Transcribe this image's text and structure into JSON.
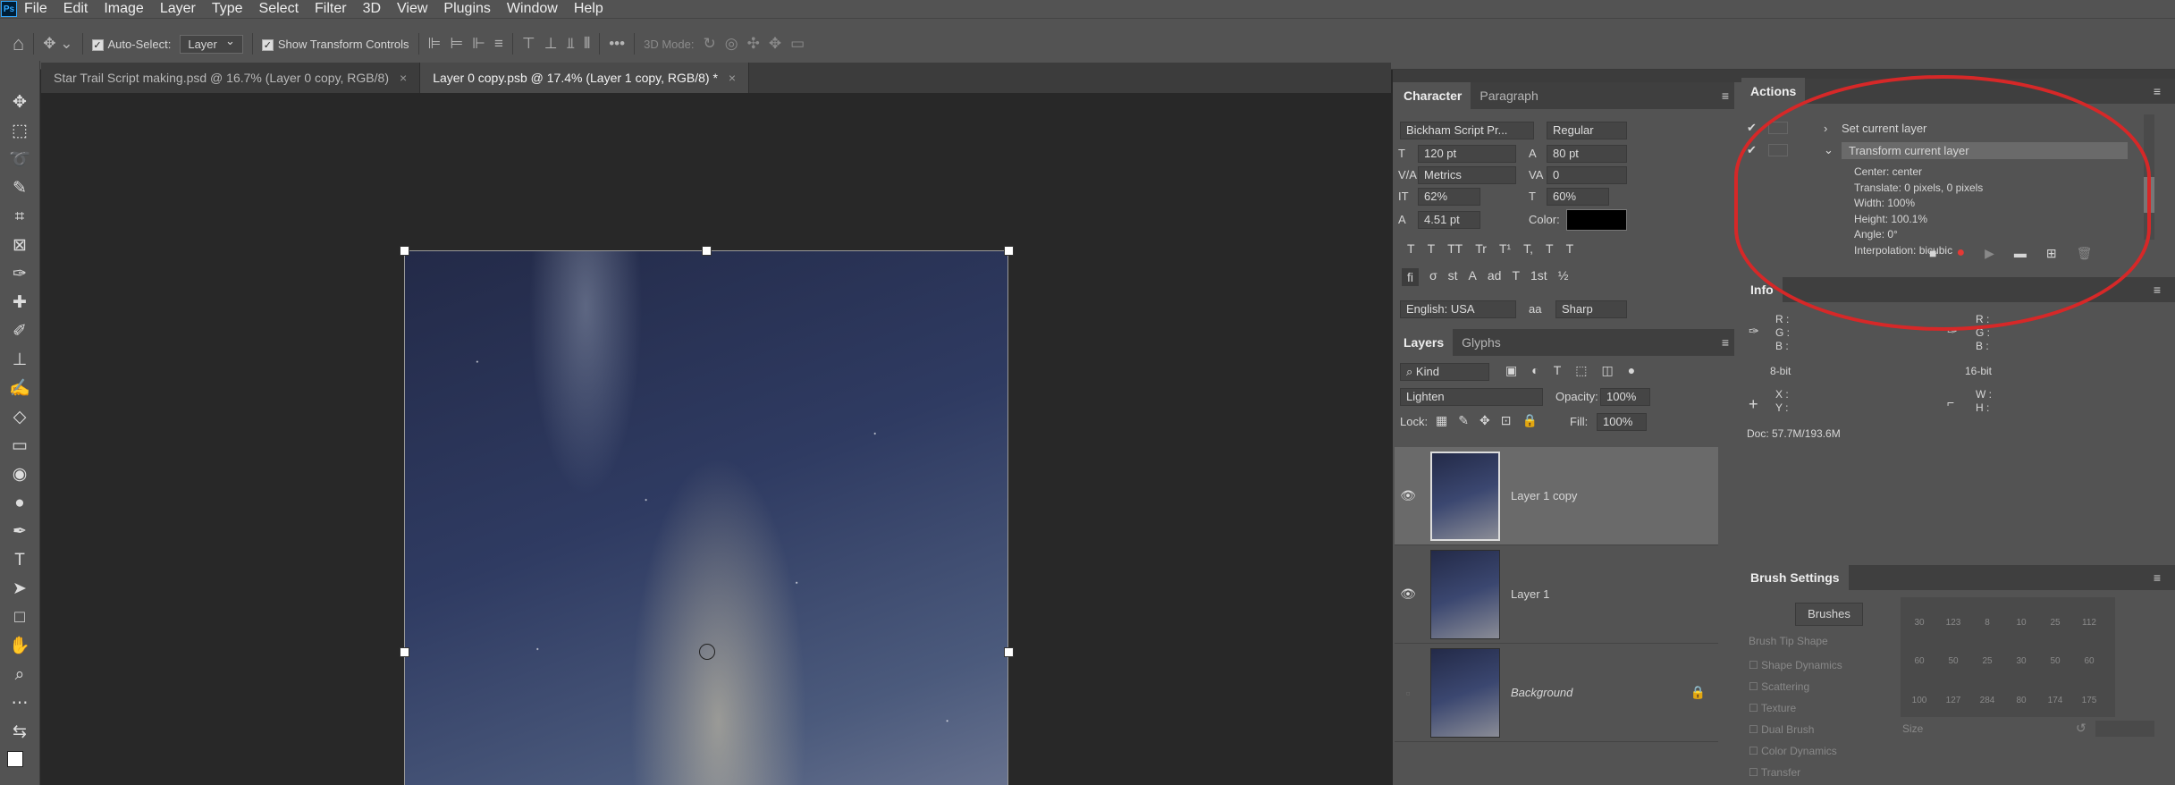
{
  "menu": [
    "File",
    "Edit",
    "Image",
    "Layer",
    "Type",
    "Select",
    "Filter",
    "3D",
    "View",
    "Plugins",
    "Window",
    "Help"
  ],
  "options": {
    "autoselect_label": "Auto-Select:",
    "autoselect_value": "Layer",
    "transform_label": "Show Transform Controls",
    "mode_label": "3D Mode:",
    "more": "•••"
  },
  "tabs": [
    {
      "label": "Star Trail Script making.psd @ 16.7% (Layer 0 copy, RGB/8)"
    },
    {
      "label": "Layer 0 copy.psb @ 17.4% (Layer 1 copy, RGB/8) *"
    }
  ],
  "character": {
    "tab1": "Character",
    "tab2": "Paragraph",
    "font": "Bickham Script Pr...",
    "style": "Regular",
    "size": "120 pt",
    "leading": "80 pt",
    "kerning": "Metrics",
    "tracking": "0",
    "vscale": "62%",
    "hscale": "60%",
    "baseline": "4.51 pt",
    "color_label": "Color:",
    "language": "English: USA",
    "aa_label": "aa",
    "antialias": "Sharp",
    "style_buttons": [
      "T",
      "T",
      "TT",
      "Tr",
      "T¹",
      "T,",
      "T",
      "T"
    ],
    "ot_buttons": [
      "fi",
      "σ",
      "st",
      "A",
      "ad",
      "T",
      "1st",
      "½"
    ]
  },
  "layers": {
    "tab1": "Layers",
    "tab2": "Glyphs",
    "kind": "Kind",
    "blend": "Lighten",
    "opacity_label": "Opacity:",
    "opacity": "100%",
    "lock_label": "Lock:",
    "fill_label": "Fill:",
    "fill": "100%",
    "items": [
      {
        "name": "Layer 1 copy",
        "visible": "true"
      },
      {
        "name": "Layer 1",
        "visible": "true"
      },
      {
        "name": "Background",
        "visible": "false"
      }
    ]
  },
  "actions": {
    "title": "Actions",
    "set_layer": "Set current layer",
    "transform_layer": "Transform current layer",
    "details": [
      "Center: center",
      "Translate: 0 pixels, 0 pixels",
      "Width: 100%",
      "Height: 100.1%",
      "Angle: 0°",
      "Interpolation: bicubic"
    ]
  },
  "info": {
    "title": "Info",
    "rgb": "R :\nG :\nB :",
    "bits1": "8-bit",
    "bits2": "16-bit",
    "xy": "X :\nY :",
    "wh": "W :\nH :",
    "doc": "Doc: 57.7M/193.6M"
  },
  "brush": {
    "title": "Brush Settings",
    "brushes_btn": "Brushes",
    "tip_shape": "Brush Tip Shape",
    "options": [
      "Shape Dynamics",
      "Scattering",
      "Texture",
      "Dual Brush",
      "Color Dynamics",
      "Transfer"
    ],
    "sizes": [
      "30",
      "123",
      "8",
      "10",
      "25",
      "112",
      "60",
      "50",
      "25",
      "30",
      "50",
      "60",
      "100",
      "127",
      "284",
      "80",
      "174",
      "175"
    ],
    "size_label": "Size"
  }
}
